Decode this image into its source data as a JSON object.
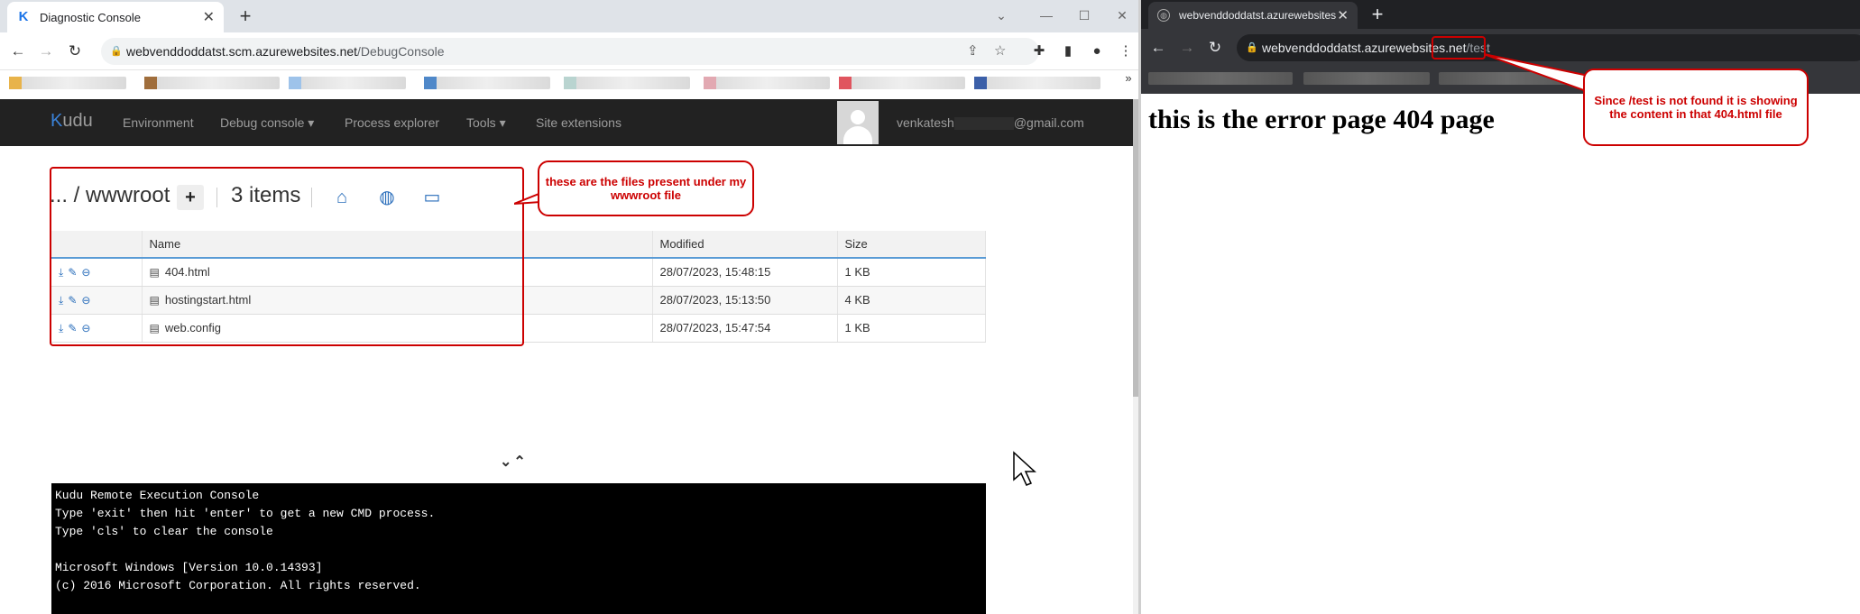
{
  "left_browser": {
    "tab_title": "Diagnostic Console",
    "url_host": "webvenddoddatst.scm.azurewebsites.net",
    "url_path": "/DebugConsole"
  },
  "kudu": {
    "brand_k": "K",
    "brand_rest": "udu",
    "nav": [
      "Environment",
      "Debug console ▾",
      "Process explorer",
      "Tools ▾",
      "Site extensions"
    ],
    "user_prefix": "venkatesh",
    "user_suffix": "@gmail.com"
  },
  "folder": {
    "breadcrumb": "... / wwwroot",
    "add_label": "+",
    "item_count": "3 items"
  },
  "files": {
    "headers": [
      "",
      "Name",
      "Modified",
      "Size"
    ],
    "rows": [
      {
        "name": "404.html",
        "modified": "28/07/2023, 15:48:15",
        "size": "1 KB"
      },
      {
        "name": "hostingstart.html",
        "modified": "28/07/2023, 15:13:50",
        "size": "4 KB"
      },
      {
        "name": "web.config",
        "modified": "28/07/2023, 15:47:54",
        "size": "1 KB"
      }
    ]
  },
  "annotations": {
    "files_callout": "these are the files present under my wwwroot file",
    "notfound_callout": "Since /test is not found it is showing the content in that 404.html file"
  },
  "console": {
    "lines": [
      "Kudu Remote Execution Console",
      "Type 'exit' then hit 'enter' to get a new CMD process.",
      "Type 'cls' to clear the console",
      "",
      "Microsoft Windows [Version 10.0.14393]",
      "(c) 2016 Microsoft Corporation. All rights reserved."
    ]
  },
  "right_browser": {
    "tab_title": "webvenddoddatst.azurewebsites.",
    "url_host": "webvenddoddatst.azurewebsites.net",
    "url_path": "/test",
    "page_heading": "this is the error page 404 page"
  },
  "colors": {
    "accent": "#3a82d8",
    "annotation": "#cc0000",
    "navbar": "#222222"
  }
}
